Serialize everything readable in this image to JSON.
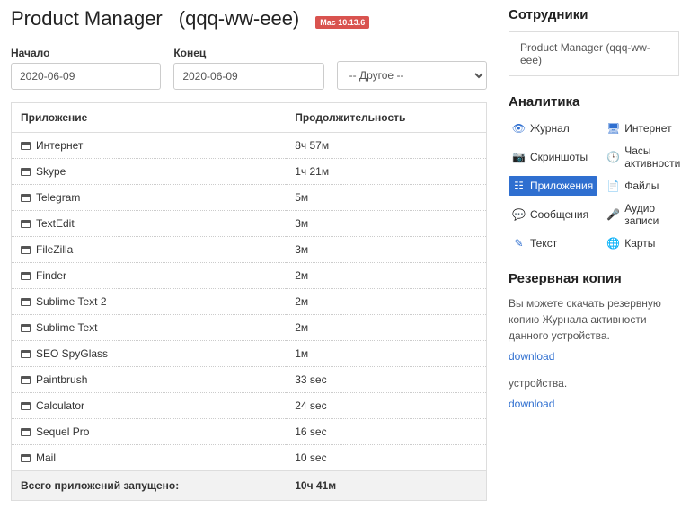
{
  "header": {
    "title": "Product Manager",
    "subtitle": "(qqq-ww-eee)",
    "badge": "Mac 10.13.6"
  },
  "filters": {
    "start_label": "Начало",
    "start_value": "2020-06-09",
    "end_label": "Конец",
    "end_value": "2020-06-09",
    "other_value": "-- Другое --"
  },
  "table": {
    "col_app": "Приложение",
    "col_duration": "Продолжительность",
    "rows": [
      {
        "app": "Интернет",
        "duration": "8ч 57м"
      },
      {
        "app": "Skype",
        "duration": "1ч 21м"
      },
      {
        "app": "Telegram",
        "duration": "5м"
      },
      {
        "app": "TextEdit",
        "duration": "3м"
      },
      {
        "app": "FileZilla",
        "duration": "3м"
      },
      {
        "app": "Finder",
        "duration": "2м"
      },
      {
        "app": "Sublime Text 2",
        "duration": "2м"
      },
      {
        "app": "Sublime Text",
        "duration": "2м"
      },
      {
        "app": "SEO SpyGlass",
        "duration": "1м"
      },
      {
        "app": "Paintbrush",
        "duration": "33 sec"
      },
      {
        "app": "Calculator",
        "duration": "24 sec"
      },
      {
        "app": "Sequel Pro",
        "duration": "16 sec"
      },
      {
        "app": "Mail",
        "duration": "10 sec"
      }
    ],
    "footer_label": "Всего приложений запущено:",
    "footer_value": "10ч 41м"
  },
  "sidebar": {
    "employees_heading": "Сотрудники",
    "employee_selected": "Product Manager (qqq-ww-eee)",
    "analytics_heading": "Аналитика",
    "nav": [
      {
        "label": "Журнал",
        "icon": "eye-icon",
        "active": false
      },
      {
        "label": "Интернет",
        "icon": "monitor-icon",
        "active": false
      },
      {
        "label": "Скриншоты",
        "icon": "camera-icon",
        "active": false
      },
      {
        "label": "Часы активности",
        "icon": "clock-icon",
        "active": false
      },
      {
        "label": "Приложения",
        "icon": "grid-icon",
        "active": true
      },
      {
        "label": "Файлы",
        "icon": "file-icon",
        "active": false
      },
      {
        "label": "Сообщения",
        "icon": "chat-icon",
        "active": false
      },
      {
        "label": "Аудио записи",
        "icon": "mic-icon",
        "active": false
      },
      {
        "label": "Текст",
        "icon": "text-icon",
        "active": false
      },
      {
        "label": "Карты",
        "icon": "globe-icon",
        "active": false
      }
    ],
    "backup_heading": "Резервная копия",
    "backup_text1": "Вы можете скачать резервную копию Журнала активности данного устройства.",
    "download_label": "download",
    "backup_text2": "устройства."
  },
  "icons": {
    "eye-icon": "👁",
    "monitor-icon": "🖥",
    "camera-icon": "📷",
    "clock-icon": "🕒",
    "grid-icon": "☷",
    "file-icon": "📄",
    "chat-icon": "💬",
    "mic-icon": "🎤",
    "text-icon": "✎",
    "globe-icon": "🌐"
  }
}
